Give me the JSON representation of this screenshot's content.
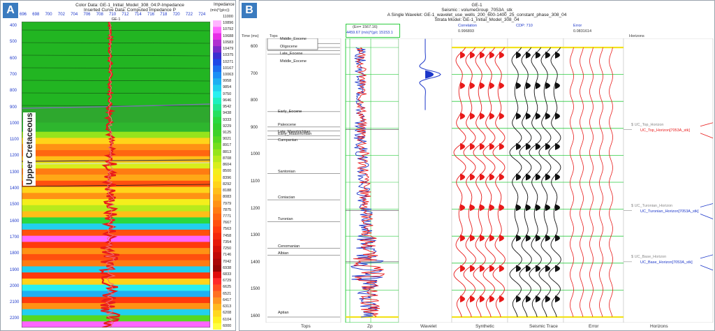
{
  "panel_a": {
    "label": "A",
    "color_data_title": "Color Data: GE-1_Initial_Model_308_04:P-Impedance",
    "curve_data_title": "Inserted Curve Data: Computed Impedance P",
    "well_name": "GE-1",
    "top_ticks": [
      "696",
      "698",
      "700",
      "702",
      "704",
      "706",
      "708",
      "710",
      "712",
      "714",
      "716",
      "718",
      "720",
      "722",
      "724"
    ],
    "depth_ticks": [
      "400",
      "500",
      "600",
      "700",
      "800",
      "900",
      "1000",
      "1100",
      "1200",
      "1300",
      "1400",
      "1500",
      "1600",
      "1700",
      "1800",
      "1900",
      "2000",
      "2100",
      "2200"
    ],
    "colorbar_title": "Impedance",
    "colorbar_unit": "(m/s)*(g/cc))",
    "colorbar_values": [
      "11000",
      "10896",
      "10792",
      "10688",
      "10583",
      "10479",
      "10375",
      "10271",
      "10167",
      "10063",
      "9958",
      "9854",
      "9750",
      "9646",
      "9542",
      "9438",
      "9333",
      "9229",
      "9125",
      "9021",
      "8917",
      "8813",
      "8708",
      "8604",
      "8500",
      "8396",
      "8292",
      "8188",
      "8083",
      "7979",
      "7875",
      "7771",
      "7667",
      "7563",
      "7458",
      "7354",
      "7250",
      "7146",
      "7042",
      "6938",
      "6833",
      "6729",
      "6625",
      "6521",
      "6417",
      "6313",
      "6208",
      "6104",
      "6000"
    ],
    "annotation": "Upper Cretaceous"
  },
  "panel_b": {
    "label": "B",
    "header_line1": "GE-1",
    "header_line2": "Seismic : volumeGroup_7053A_stk",
    "header_line3": "A Single Wavelet: GE-1_wavelet_use_wells_200_600-1400_25_constant_phase_308_04",
    "header_line4": "Strata Model: GE-1_Initial_Model_308_04",
    "time_label": "Time (ms)",
    "tops_label": "Tops",
    "zp_err": "(Err= 1567.16)",
    "zp_range": "4459.67  (m/s)*(g/c  15153.1",
    "correlation_label": "Correlation",
    "correlation_value": "0.996893",
    "cdp_label": "CDP: 710",
    "error_label": "Error",
    "error_value": "0.0831614",
    "horizons_label": "Horizons",
    "time_ticks": [
      "600",
      "700",
      "800",
      "900",
      "1000",
      "1100",
      "1200",
      "1300",
      "1400",
      "1500",
      "1600"
    ],
    "tops": [
      "Middle_Eocene",
      "Oligocene",
      "Late_Eocene",
      "Middle_Eocene",
      "Early_Eocene",
      "Paleocene",
      "Late_Maastrichtian",
      "Early_Maastrichtian",
      "Campanian",
      "Santonian",
      "Coniacian",
      "Turonian",
      "Cenomanian",
      "Albian",
      "Aptian"
    ],
    "horizons": [
      {
        "top": "$ UC_Top_Horizon",
        "bottom": "UC_Top_Horizon[7053A_stk]"
      },
      {
        "top": "$ UC_Turonian_Horizon",
        "bottom": "UC_Turonian_Horizon[7053A_stk]"
      },
      {
        "top": "$ UC_Base_Horizon",
        "bottom": "UC_Base_Horizon[7053A_stk]"
      }
    ],
    "bottom_labels": {
      "tops": "Tops",
      "zp": "Zp",
      "wavelet": "Wavelet",
      "synthetic": "Synthetic",
      "seismic": "Seismic Trace",
      "error": "Error",
      "horizons": "Horizons"
    }
  }
}
